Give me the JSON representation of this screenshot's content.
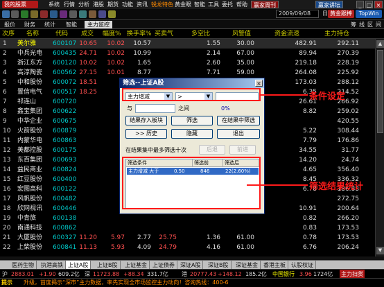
{
  "menubar": {
    "logo": "我的股票",
    "items": [
      "系统",
      "行情",
      "分析",
      "港股",
      "期货",
      "功能",
      "资讯",
      "锐龙特色",
      "黄金眼",
      "智能",
      "工具",
      "委托",
      "帮助"
    ],
    "highlight": "赢家周刊",
    "right_btn": "赢家讲坛"
  },
  "toolbar": {
    "date": "2009/09/08",
    "period": "日线",
    "btn1": "黄金跟棒",
    "btn2": "TopWin"
  },
  "tabs": [
    "报价",
    "财务",
    "统计",
    "智能",
    "主力监控"
  ],
  "selected_tab": "主力监控",
  "tab_right": [
    "筹",
    "线",
    "区",
    "间"
  ],
  "columns": [
    "次序",
    "名称",
    "代码",
    "成交",
    "幅度%",
    "换手率%",
    "买卖气",
    "多空比",
    "风警值",
    "资金流速",
    "主力持仓"
  ],
  "rows": [
    {
      "idx": "1",
      "name": "美尔雅",
      "code": "600107",
      "vol": "10.65",
      "amp": "10.02",
      "turn": "10.57",
      "buy": "",
      "ls": "1.55",
      "risk": "30.00",
      "flow": "482.91",
      "pos": "292.11"
    },
    {
      "idx": "2",
      "name": "中兵光电",
      "code": "600435",
      "vol": "24.71",
      "amp": "10.02",
      "turn": "10.99",
      "buy": "",
      "ls": "2.14",
      "risk": "67.00",
      "flow": "89.94",
      "pos": "270.39"
    },
    {
      "idx": "3",
      "name": "浙江东方",
      "code": "600120",
      "vol": "10.02",
      "amp": "10.02",
      "turn": "1.65",
      "buy": "",
      "ls": "2.60",
      "risk": "35.00",
      "flow": "219.18",
      "pos": "228.19"
    },
    {
      "idx": "4",
      "name": "高淳陶瓷",
      "code": "600562",
      "vol": "27.15",
      "amp": "10.01",
      "turn": "8.77",
      "buy": "",
      "ls": "7.71",
      "risk": "59.00",
      "flow": "264.08",
      "pos": "225.92"
    },
    {
      "idx": "5",
      "name": "中和股份",
      "code": "600072",
      "vol": "18.51",
      "amp": "",
      "turn": "",
      "buy": "",
      "ls": "",
      "risk": "",
      "flow": "173.03",
      "pos": "288.12"
    },
    {
      "idx": "6",
      "name": "置信电气",
      "code": "600517",
      "vol": "18.25",
      "amp": "",
      "turn": "",
      "buy": "",
      "ls": "",
      "risk": "",
      "flow": "6.35",
      "pos": "214.52"
    },
    {
      "idx": "7",
      "name": "祁连山",
      "code": "600720",
      "vol": "",
      "amp": "",
      "turn": "",
      "buy": "",
      "ls": "",
      "risk": "",
      "flow": "26.61",
      "pos": "266.92"
    },
    {
      "idx": "8",
      "name": "鑫宝集团",
      "code": "600622",
      "vol": "",
      "amp": "",
      "turn": "",
      "buy": "",
      "ls": "",
      "risk": "",
      "flow": "8.82",
      "pos": "259.02"
    },
    {
      "idx": "9",
      "name": "中华企业",
      "code": "600675",
      "vol": "",
      "amp": "",
      "turn": "",
      "buy": "",
      "ls": "",
      "risk": "",
      "flow": "",
      "pos": "420.55"
    },
    {
      "idx": "10",
      "name": "火箭股份",
      "code": "600879",
      "vol": "",
      "amp": "",
      "turn": "",
      "buy": "",
      "ls": "",
      "risk": "",
      "flow": "5.22",
      "pos": "308.44"
    },
    {
      "idx": "11",
      "name": "内蒙华电",
      "code": "600863",
      "vol": "",
      "amp": "",
      "turn": "",
      "buy": "",
      "ls": "",
      "risk": "",
      "flow": "7.79",
      "pos": "176.86"
    },
    {
      "idx": "12",
      "name": "美都控股",
      "code": "600175",
      "vol": "",
      "amp": "",
      "turn": "",
      "buy": "",
      "ls": "",
      "risk": "",
      "flow": "34.55",
      "pos": "31.77"
    },
    {
      "idx": "13",
      "name": "东百集团",
      "code": "600693",
      "vol": "",
      "amp": "",
      "turn": "",
      "buy": "",
      "ls": "",
      "risk": "",
      "flow": "14.20",
      "pos": "24.74"
    },
    {
      "idx": "14",
      "name": "益民商业",
      "code": "600824",
      "vol": "",
      "amp": "",
      "turn": "",
      "buy": "",
      "ls": "",
      "risk": "",
      "flow": "4.65",
      "pos": "356.40"
    },
    {
      "idx": "15",
      "name": "红豆股份",
      "code": "600400",
      "vol": "",
      "amp": "",
      "turn": "",
      "buy": "",
      "ls": "",
      "risk": "",
      "flow": "8.45",
      "pos": "336.32"
    },
    {
      "idx": "16",
      "name": "宏图高科",
      "code": "600122",
      "vol": "",
      "amp": "",
      "turn": "",
      "buy": "",
      "ls": "",
      "risk": "",
      "flow": "6.78",
      "pos": "186.88"
    },
    {
      "idx": "17",
      "name": "风帆股份",
      "code": "600482",
      "vol": "",
      "amp": "",
      "turn": "",
      "buy": "",
      "ls": "",
      "risk": "",
      "flow": "",
      "pos": "272.75"
    },
    {
      "idx": "18",
      "name": "欣网视讯",
      "code": "600446",
      "vol": "",
      "amp": "",
      "turn": "",
      "buy": "",
      "ls": "",
      "risk": "",
      "flow": "10.91",
      "pos": "200.64"
    },
    {
      "idx": "19",
      "name": "中青旅",
      "code": "600138",
      "vol": "",
      "amp": "",
      "turn": "",
      "buy": "",
      "ls": "",
      "risk": "",
      "flow": "0.82",
      "pos": "266.20"
    },
    {
      "idx": "20",
      "name": "南通科技",
      "code": "600862",
      "vol": "",
      "amp": "",
      "turn": "",
      "buy": "",
      "ls": "",
      "risk": "",
      "flow": "0.83",
      "pos": "173.53"
    },
    {
      "idx": "21",
      "name": "大厦股份",
      "code": "600327",
      "vol": "11.20",
      "amp": "5.97",
      "turn": "2.77",
      "buy": "25.75",
      "ls": "1.36",
      "risk": "61.00",
      "flow": "0.78",
      "pos": "173.53"
    },
    {
      "idx": "22",
      "name": "上柴股份",
      "code": "600841",
      "vol": "11.13",
      "amp": "5.93",
      "turn": "4.09",
      "buy": "24.79",
      "ls": "4.16",
      "risk": "61.00",
      "flow": "6.76",
      "pos": "206.24"
    }
  ],
  "dialog": {
    "title": "筛选--上证A股",
    "field": "主力增减",
    "op": ">",
    "and_label": "与",
    "between_label": "之间",
    "progress": "0%",
    "btn_save_block": "结果存入板块",
    "btn_filter": "筛选",
    "btn_filter_in_result": "在结果中筛选",
    "btn_history": ">>  历史",
    "btn_hide": "隐藏",
    "btn_exit": "退出",
    "result_label": "在结果集中最多筛选十次",
    "btn_prev": "后退",
    "btn_next": "前进",
    "list_headers": [
      "筛选条件",
      "筛选前",
      "筛选后"
    ],
    "list_row": {
      "cond": "主力增减 大于",
      "val": "0.50",
      "before": "846",
      "after": "22(2.60%)"
    }
  },
  "annotations": {
    "cond_label": "条件设定",
    "result_label": "筛选结果统计"
  },
  "bottom_tabs": [
    "医药生物",
    "执港高铁",
    "上证A股",
    "上证B股",
    "上证基金",
    "上证债券",
    "深证A股",
    "深证B股",
    "深证基金",
    "香港主板",
    "认股权证"
  ],
  "selected_bottom_tab": "上证A股",
  "ticker": {
    "sh_label": "沪",
    "sh_idx": "2883.01",
    "sh_chg": "+1.90",
    "sh_amt": "609.2亿",
    "sz_label": "深",
    "sz_idx": "11723.88",
    "sz_chg": "+88.34",
    "sz_amt": "331.7亿",
    "hk_label": "港",
    "hk_idx": "20777.43",
    "hk_chg": "+148.12",
    "hk_amt": "185.2亿",
    "stock_name": "中国银行",
    "stock_price": "3.96",
    "stock_amt": "1724亿",
    "tag": "主力扫货"
  },
  "status": {
    "logo": "提示",
    "text": "升级，首度揭示“深市”主力数据，率先实现全市场监控主力动向！咨询热线：400-6"
  }
}
